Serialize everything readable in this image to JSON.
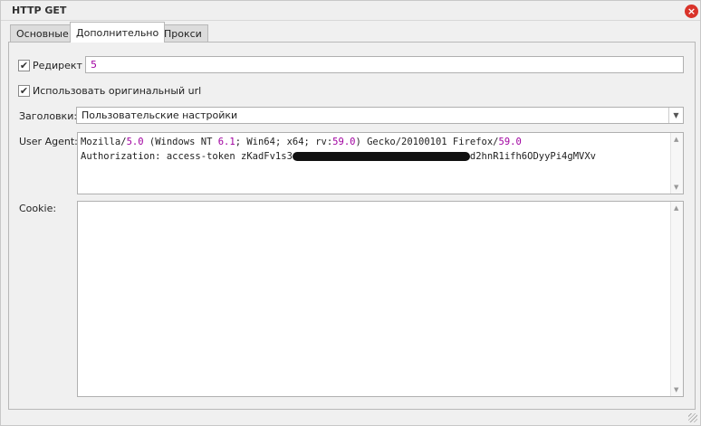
{
  "window": {
    "title": "HTTP GET"
  },
  "tabs": [
    {
      "label": "Основные"
    },
    {
      "label": "Дополнительно",
      "active": true
    },
    {
      "label": "Прокси"
    }
  ],
  "redirect": {
    "label": "Редирект",
    "checked": true,
    "value": "5"
  },
  "original_url": {
    "label": "Использовать оригинальный url",
    "checked": true
  },
  "headers": {
    "label": "Заголовки:",
    "value": "Пользовательские настройки"
  },
  "user_agent": {
    "label": "User Agent:",
    "line1": {
      "a": "Mozilla/",
      "b": "5.0",
      "c": " (Windows NT ",
      "d": "6.1",
      "e": "; Win64; x64; rv:",
      "f": "59.0",
      "g": ") Gecko/20100101 Firefox/",
      "h": "59.0"
    },
    "line2": {
      "prefix": "Authorization: access-token zKadFv1s3",
      "suffix": "d2hnR1ifh6ODyyPi4gMVXv"
    }
  },
  "cookie": {
    "label": "Cookie:",
    "value": ""
  },
  "colors": {
    "number": "#a000a0",
    "close": "#d9332a"
  }
}
